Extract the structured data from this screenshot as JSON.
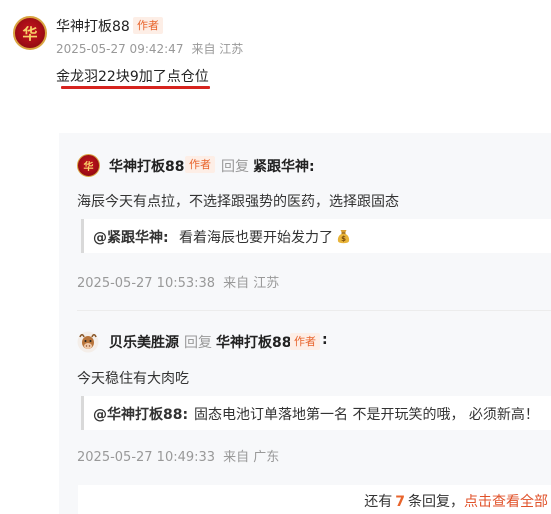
{
  "main_comment": {
    "avatar_glyph": "华",
    "username": "华神打板88",
    "author_badge": "作者",
    "timestamp": "2025-05-27 09:42:47",
    "location": "来自 江苏",
    "content": "金龙羽22块9加了点仓位"
  },
  "replies": [
    {
      "avatar_glyph": "华",
      "username": "华神打板88",
      "author_badge": "作者",
      "reply_word": "回复",
      "reply_to": "紧跟华神:",
      "content": "海辰今天有点拉，不选择跟强势的医药，选择跟固态",
      "quote_user": "@紧跟华神:",
      "quote_text": "看着海辰也要开始发力了",
      "quote_icon": "money-bag-icon",
      "timestamp": "2025-05-27 10:53:38",
      "location": "来自 江苏"
    },
    {
      "avatar_icon": "cow-icon",
      "username": "贝乐美胜源",
      "reply_word": "回复",
      "reply_to": "华神打板88",
      "author_badge": "作者",
      "colon": ":",
      "content": "今天稳住有大肉吃",
      "quote_user": "@华神打板88:",
      "quote_text": "固态电池订单落地第一名 不是开玩笑的哦， 必须新高！",
      "timestamp": "2025-05-27 10:49:33",
      "location": "来自 广东"
    }
  ],
  "more_replies": {
    "prefix": "还有",
    "count": "7",
    "suffix": "条回复，",
    "link": "点击查看全部"
  },
  "colors": {
    "accent": "#e8642c",
    "underline": "#d6231e",
    "avatar_red": "#a30d16",
    "avatar_gold": "#d9a441",
    "panel_bg": "#f7f8fa"
  }
}
